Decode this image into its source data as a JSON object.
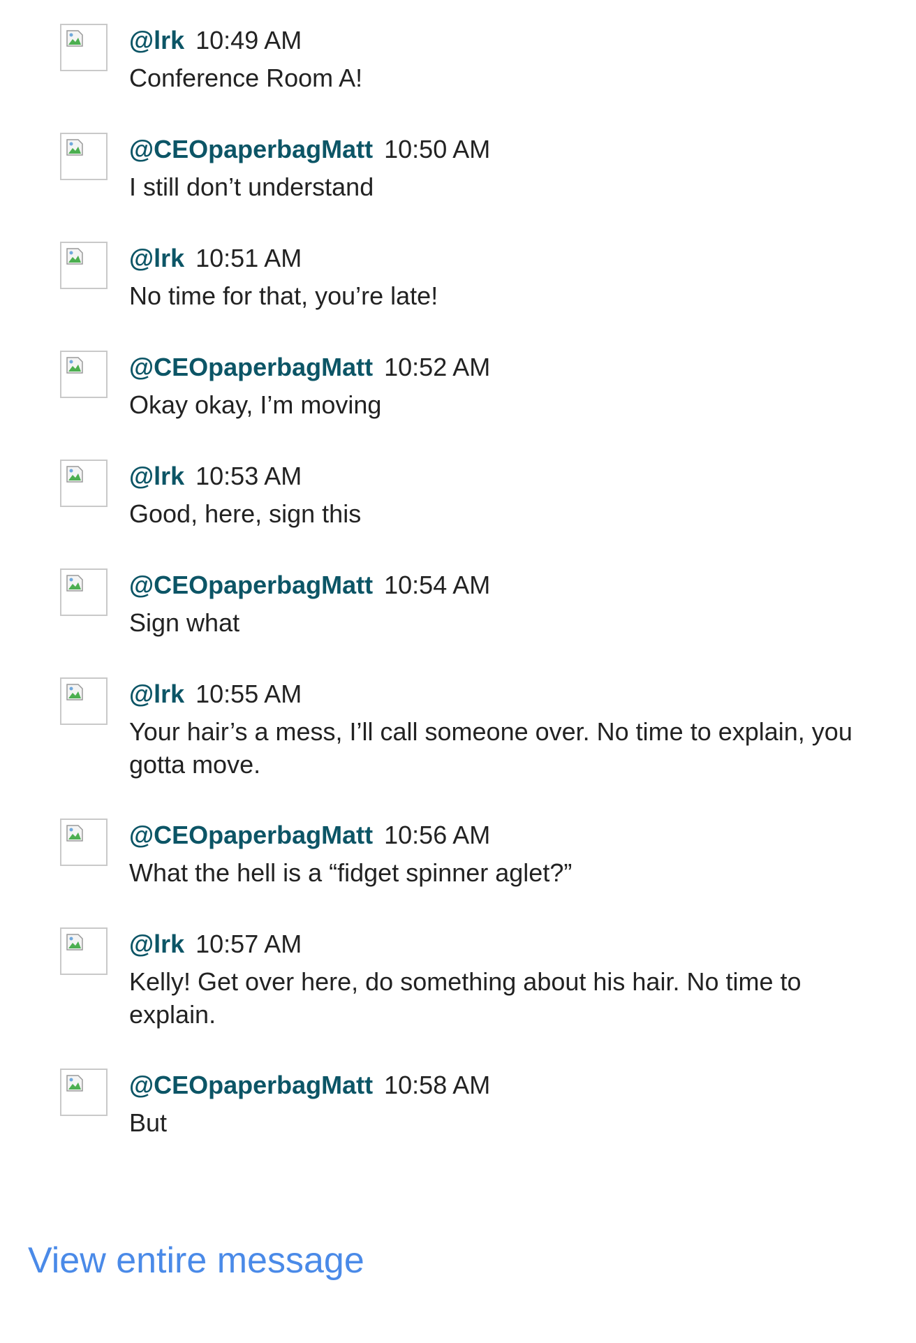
{
  "messages": [
    {
      "user": "@lrk",
      "time": "10:49 AM",
      "text": "Conference Room A!"
    },
    {
      "user": "@CEOpaperbagMatt",
      "time": "10:50 AM",
      "text": "I still don’t understand"
    },
    {
      "user": "@lrk",
      "time": "10:51 AM",
      "text": "No time for that, you’re late!"
    },
    {
      "user": "@CEOpaperbagMatt",
      "time": "10:52 AM",
      "text": "Okay okay, I’m moving"
    },
    {
      "user": "@lrk",
      "time": "10:53 AM",
      "text": "Good, here, sign this"
    },
    {
      "user": "@CEOpaperbagMatt",
      "time": "10:54 AM",
      "text": "Sign what"
    },
    {
      "user": "@lrk",
      "time": "10:55 AM",
      "text": "Your hair’s a mess, I’ll call someone over. No time to explain, you gotta move."
    },
    {
      "user": "@CEOpaperbagMatt",
      "time": "10:56 AM",
      "text": "What the hell is a “fidget spinner aglet?”"
    },
    {
      "user": "@lrk",
      "time": "10:57 AM",
      "text": "Kelly! Get over here, do something about his hair. No time to explain."
    },
    {
      "user": "@CEOpaperbagMatt",
      "time": "10:58 AM",
      "text": "But"
    }
  ],
  "footer": {
    "view_link": "View entire message"
  },
  "colors": {
    "username": "#0c5566",
    "text": "#222222",
    "link": "#4a8ae8"
  },
  "icons": {
    "avatar": "broken-image-icon"
  }
}
